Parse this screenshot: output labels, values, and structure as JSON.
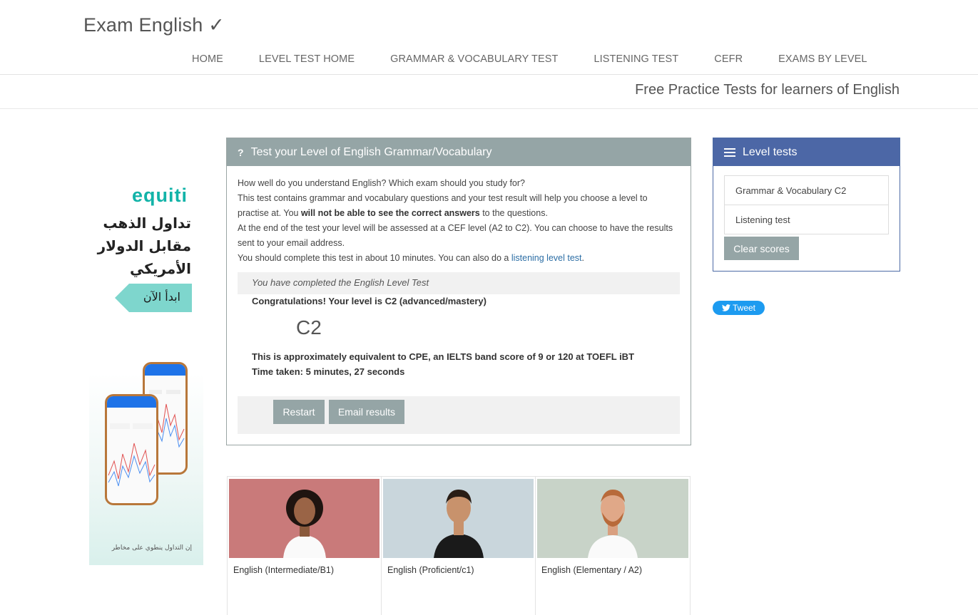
{
  "brand": "Exam English ✓",
  "nav": [
    "HOME",
    "LEVEL TEST HOME",
    "GRAMMAR & VOCABULARY TEST",
    "LISTENING TEST",
    "CEFR",
    "EXAMS BY LEVEL"
  ],
  "tagline": "Free Practice Tests for learners of English",
  "ad": {
    "logo": "equiti",
    "headline": [
      "تداول الذهب",
      "مقابل الدولار",
      "الأمريكي"
    ],
    "cta": "ابدأ الآن",
    "disclaimer": "إن التداول ينطوي على مخاطر"
  },
  "panel": {
    "icon": "?",
    "title": "Test your Level of English Grammar/Vocabulary",
    "line1": "How well do you understand English? Which exam should you study for?",
    "line2a": "This test contains grammar and vocabulary questions and your test result will help you choose a level to practise at. You ",
    "line2b": "will not be able to see the correct answers",
    "line2c": " to the questions.",
    "line3": "At the end of the test your level will be assessed at a CEF level (A2 to C2). You can choose to have the results sent to your email address.",
    "line4a": "You should complete this test in about 10 minutes. You can also do a ",
    "line4link": "listening level test",
    "line4b": ".",
    "completed": "You have completed the English Level Test",
    "congrats": "Congratulations! Your level is C2 (advanced/mastery)",
    "level": "C2",
    "equivalent": "This is approximately equivalent to CPE, an IELTS band score of 9 or 120 at TOEFL iBT",
    "time": "Time taken: 5 minutes, 27 seconds",
    "restart": "Restart",
    "email": "Email results"
  },
  "side": {
    "title": "Level tests",
    "items": [
      "Grammar & Vocabulary C2",
      "Listening test"
    ],
    "clear": "Clear scores"
  },
  "tweet": "Tweet",
  "cards": [
    {
      "caption": "English (Intermediate/B1)",
      "bg": "#c97a7a"
    },
    {
      "caption": "English (Proficient/c1)",
      "bg": "#c9d6dc"
    },
    {
      "caption": "English (Elementary / A2)",
      "bg": "#c8d3c8"
    }
  ]
}
